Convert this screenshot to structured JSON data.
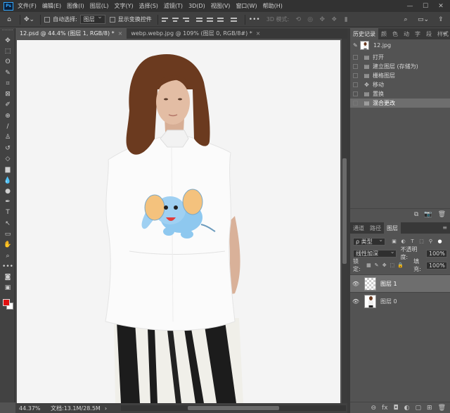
{
  "app": {
    "logo": "Ps"
  },
  "menu": [
    "文件(F)",
    "编辑(E)",
    "图像(I)",
    "图层(L)",
    "文字(Y)",
    "选择(S)",
    "滤镜(T)",
    "3D(D)",
    "视图(V)",
    "窗口(W)",
    "帮助(H)"
  ],
  "window_controls": {
    "minimize": "—",
    "maximize": "☐",
    "close": "✕"
  },
  "options": {
    "auto_select_label": "自动选择:",
    "auto_select_value": "图层",
    "show_transform_label": "显示变换控件",
    "more": "•••",
    "mode_3d": "3D 模式:"
  },
  "tabs": [
    {
      "label": "12.psd @ 44.4% (图层 1, RGB/8) *",
      "close": "×"
    },
    {
      "label": "webp.webp.jpg @ 109% (图层 0, RGB/8#) *",
      "close": "×"
    }
  ],
  "toolbar": {
    "icons": [
      "move-icon",
      "marquee-icon",
      "lasso-icon",
      "quick-select-icon",
      "crop-icon",
      "frame-icon",
      "eyedropper-icon",
      "healing-icon",
      "brush-icon",
      "stamp-icon",
      "history-brush-icon",
      "eraser-icon",
      "gradient-icon",
      "blur-icon",
      "dodge-icon",
      "pen-icon",
      "type-icon",
      "path-select-icon",
      "shape-icon",
      "hand-icon",
      "zoom-icon",
      "more-tools-icon",
      "colors-icon",
      "quickmask-icon",
      "screen-mode-icon"
    ],
    "glyphs": [
      "✥",
      "⬚",
      "ʘ",
      "✎",
      "⌗",
      "⊠",
      "✐",
      "⊕",
      "/",
      "♙",
      "↺",
      "◇",
      "▆",
      "💧",
      "●",
      "✒",
      "T",
      "↖",
      "▭",
      "✋",
      "⌕",
      "•••",
      "",
      "◙",
      "▣"
    ],
    "foreground_color": "#e01010",
    "background_color": "#ffffff"
  },
  "status": {
    "zoom": "44.37%",
    "doc": "文档:13.1M/28.5M",
    "arrow": "›"
  },
  "history_panel": {
    "tabs": [
      "历史记录",
      "颜",
      "色",
      "动",
      "字",
      "段",
      "样式"
    ],
    "menu": "≡",
    "snapshot": "12.jpg",
    "steps": [
      {
        "label": "打开",
        "icon": "doc-icon",
        "glyph": "▤"
      },
      {
        "label": "建立图层 (存储为)",
        "icon": "doc-icon",
        "glyph": "▤"
      },
      {
        "label": "栅格图层",
        "icon": "doc-icon",
        "glyph": "▤"
      },
      {
        "label": "移动",
        "icon": "move-icon",
        "glyph": "✥"
      },
      {
        "label": "置换",
        "icon": "doc-icon",
        "glyph": "▤"
      },
      {
        "label": "混合更改",
        "icon": "doc-icon",
        "glyph": "▤"
      }
    ],
    "selected_index": 5,
    "footer": [
      "⧉",
      "📷",
      "🗑"
    ]
  },
  "layers_panel": {
    "tabs": [
      "通道",
      "路径",
      "图层"
    ],
    "active_tab": 2,
    "menu": "≡",
    "kind_filter": "ρ 类型",
    "filter_glyphs": [
      "▣",
      "◐",
      "T",
      "⬚",
      "⚲",
      "●"
    ],
    "blend_mode": "线性加深",
    "opacity_label": "不透明度:",
    "opacity_value": "100%",
    "lock_label": "锁定:",
    "lock_glyphs": [
      "▦",
      "✎",
      "✥",
      "⬚",
      "🔒"
    ],
    "fill_label": "填充:",
    "fill_value": "100%",
    "layers": [
      {
        "name": "图层 1",
        "visible_glyph": "👁",
        "selected": true
      },
      {
        "name": "图层 0",
        "visible_glyph": "👁",
        "selected": false
      }
    ],
    "footer": [
      "⊖",
      "fx",
      "◘",
      "◐",
      "▢",
      "⊞",
      "🗑"
    ]
  }
}
